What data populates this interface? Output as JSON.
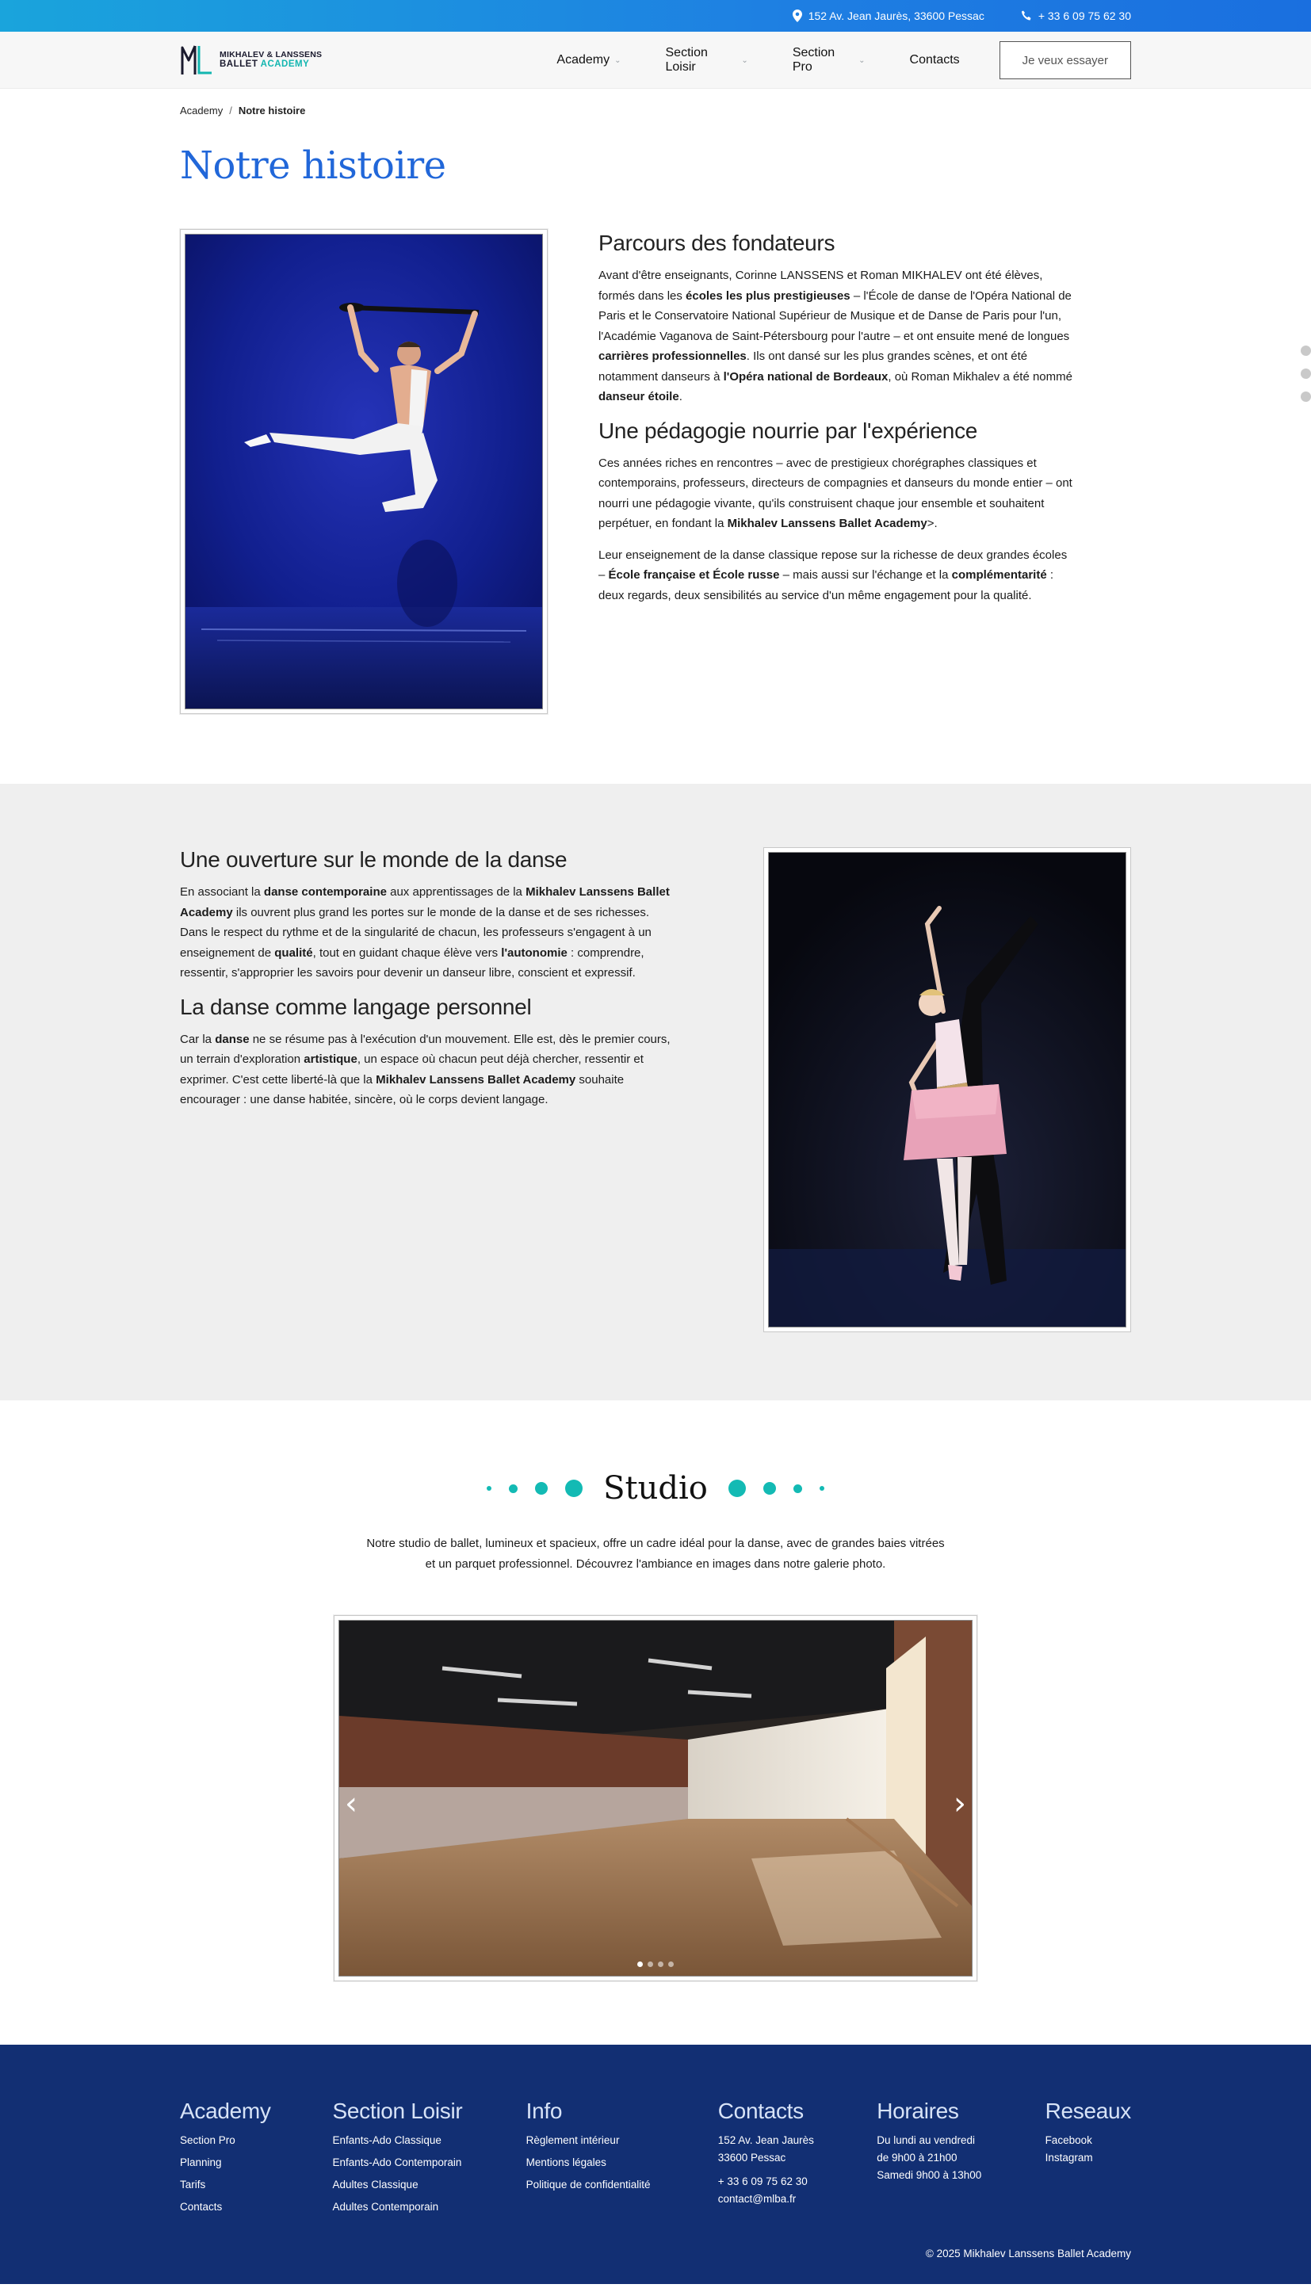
{
  "topbar": {
    "address": "152 Av. Jean Jaurès, 33600 Pessac",
    "phone": "+ 33 6 09 75 62 30"
  },
  "logo": {
    "line1": "MIKHALEV & LANSSENS",
    "line2a": "BALLET",
    "line2b": "ACADEMY"
  },
  "nav": {
    "items": [
      {
        "label": "Academy"
      },
      {
        "label": "Section Loisir"
      },
      {
        "label": "Section Pro"
      },
      {
        "label": "Contacts"
      }
    ],
    "cta": "Je veux essayer"
  },
  "breadcrumb": {
    "home": "Academy",
    "sep": "/",
    "current": "Notre histoire"
  },
  "page_title": "Notre histoire",
  "section1": {
    "h1": "Parcours des fondateurs",
    "p1": [
      {
        "t": "Avant d'être enseignants, Corinne LANSSENS et Roman MIKHALEV ont été élèves, formés dans les "
      },
      {
        "b": "écoles les plus prestigieuses"
      },
      {
        "t": " – l'École de danse de l'Opéra National de Paris et le Conservatoire National Supérieur de Musique et de Danse de Paris pour l'un, l'Académie Vaganova de Saint-Pétersbourg pour l'autre – et ont ensuite mené de longues "
      },
      {
        "b": "carrières professionnelles"
      },
      {
        "t": ". Ils ont dansé sur les plus grandes scènes, et ont été notamment danseurs à "
      },
      {
        "b": "l'Opéra national de Bordeaux"
      },
      {
        "t": ", où Roman Mikhalev a été nommé "
      },
      {
        "b": "danseur étoile"
      },
      {
        "t": "."
      }
    ],
    "h2": "Une pédagogie nourrie par l'expérience",
    "p2": [
      {
        "t": "Ces années riches en rencontres – avec de prestigieux chorégraphes classiques et contemporains, professeurs, directeurs de compagnies et danseurs du monde entier – ont nourri une pédagogie vivante, qu'ils construisent chaque jour ensemble et souhaitent perpétuer, en fondant la "
      },
      {
        "b": "Mikhalev Lanssens Ballet Academy"
      },
      {
        "t": ">."
      }
    ],
    "p3": [
      {
        "t": "Leur enseignement de la danse classique repose sur la richesse de deux grandes écoles – "
      },
      {
        "b": "École française et École russe"
      },
      {
        "t": " – mais aussi sur l'échange et la "
      },
      {
        "b": "complémentarité"
      },
      {
        "t": " : deux regards, deux sensibilités au service d'un même engagement pour la qualité."
      }
    ]
  },
  "section2": {
    "h1": "Une ouverture sur le monde de la danse",
    "p1": [
      {
        "t": "En associant la "
      },
      {
        "b": "danse contemporaine"
      },
      {
        "t": " aux apprentissages de la "
      },
      {
        "b": "Mikhalev Lanssens Ballet Academy"
      },
      {
        "t": " ils ouvrent plus grand les portes sur le monde de la danse et de ses richesses. Dans le respect du rythme et de la singularité de chacun, les professeurs s'engagent à un enseignement de "
      },
      {
        "b": "qualité"
      },
      {
        "t": ", tout en guidant chaque élève vers "
      },
      {
        "b": "l'autonomie"
      },
      {
        "t": " : comprendre, ressentir, s'approprier les savoirs pour devenir un danseur libre, conscient et expressif."
      }
    ],
    "h2": "La danse comme langage personnel",
    "p2": [
      {
        "t": "Car la "
      },
      {
        "b": "danse"
      },
      {
        "t": " ne se résume pas à l'exécution d'un mouvement. Elle est, dès le premier cours, un terrain d'exploration "
      },
      {
        "b": "artistique"
      },
      {
        "t": ", un espace où chacun peut déjà chercher, ressentir et exprimer. C'est cette liberté-là que la "
      },
      {
        "b": "Mikhalev Lanssens Ballet Academy"
      },
      {
        "t": " souhaite encourager : une danse habitée, sincère, où le corps devient langage."
      }
    ]
  },
  "studio": {
    "title": "Studio",
    "description": "Notre studio de ballet, lumineux et spacieux, offre un cadre idéal pour la danse, avec de grandes baies vitrées et un parquet professionnel. Découvrez l'ambiance en images dans notre galerie photo.",
    "gallery_active_index": 0,
    "gallery_count": 4
  },
  "footer": {
    "columns": [
      {
        "title": "Academy",
        "links": [
          "Section Pro",
          "Planning",
          "Tarifs",
          "Contacts"
        ]
      },
      {
        "title": "Section Loisir",
        "links": [
          "Enfants-Ado Classique",
          "Enfants-Ado Contemporain",
          "Adultes Classique",
          "Adultes Contemporain"
        ]
      },
      {
        "title": "Info",
        "links": [
          "Règlement intérieur",
          "Mentions légales",
          "Politique de confidentialité"
        ]
      },
      {
        "title": "Contacts",
        "address1": "152 Av. Jean Jaurès",
        "address2": "33600 Pessac",
        "phone": "+ 33 6 09 75 62 30",
        "email": "contact@mlba.fr"
      },
      {
        "title": "Horaires",
        "lines": [
          "Du lundi au vendredi",
          "de 9h00 à 21h00",
          "Samedi 9h00 à 13h00"
        ]
      },
      {
        "title": "Reseaux",
        "links": [
          "Facebook",
          "Instagram"
        ]
      }
    ],
    "copyright": "© 2025 Mikhalev Lanssens Ballet Academy"
  },
  "colors": {
    "accent_blue": "#2167d9",
    "teal": "#13bab4",
    "footer_bg": "#122f73",
    "topbar_gradient": [
      "#1aa4dc",
      "#1a6fdf"
    ]
  },
  "icons": {
    "address": "map-pin-icon",
    "phone": "phone-icon",
    "nav_dropdown": "chevron-down-icon",
    "gallery_prev": "chevron-left-icon",
    "gallery_next": "chevron-right-icon"
  }
}
